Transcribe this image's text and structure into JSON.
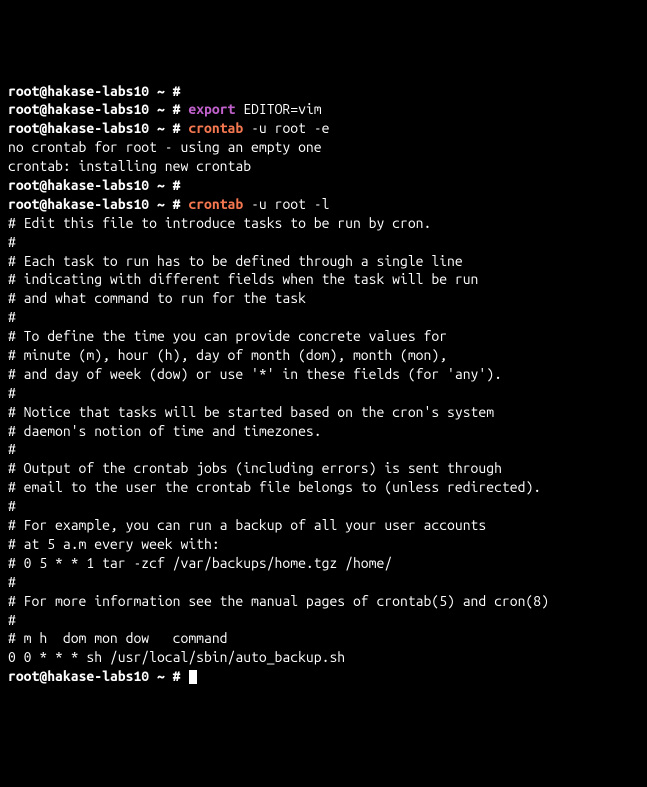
{
  "prompt": {
    "user": "root",
    "at": "@",
    "host": "hakase-labs10",
    "path": "~",
    "symbol": "#"
  },
  "lines": [
    {
      "type": "prompt",
      "cmd": []
    },
    {
      "type": "prompt",
      "cmd": [
        {
          "t": "export",
          "c": "export "
        },
        {
          "t": "plain",
          "c": "EDITOR=vim"
        }
      ]
    },
    {
      "type": "prompt",
      "cmd": [
        {
          "t": "crontab",
          "c": "crontab "
        },
        {
          "t": "plain",
          "c": "-u root -e"
        }
      ]
    },
    {
      "type": "output",
      "text": "no crontab for root - using an empty one"
    },
    {
      "type": "output",
      "text": "crontab: installing new crontab"
    },
    {
      "type": "prompt",
      "cmd": []
    },
    {
      "type": "prompt",
      "cmd": [
        {
          "t": "crontab",
          "c": "crontab "
        },
        {
          "t": "plain",
          "c": "-u root -l"
        }
      ]
    },
    {
      "type": "output",
      "text": "# Edit this file to introduce tasks to be run by cron."
    },
    {
      "type": "output",
      "text": "#"
    },
    {
      "type": "output",
      "text": "# Each task to run has to be defined through a single line"
    },
    {
      "type": "output",
      "text": "# indicating with different fields when the task will be run"
    },
    {
      "type": "output",
      "text": "# and what command to run for the task"
    },
    {
      "type": "output",
      "text": "#"
    },
    {
      "type": "output",
      "text": "# To define the time you can provide concrete values for"
    },
    {
      "type": "output",
      "text": "# minute (m), hour (h), day of month (dom), month (mon),"
    },
    {
      "type": "output",
      "text": "# and day of week (dow) or use '*' in these fields (for 'any')."
    },
    {
      "type": "output",
      "text": "#"
    },
    {
      "type": "output",
      "text": "# Notice that tasks will be started based on the cron's system"
    },
    {
      "type": "output",
      "text": "# daemon's notion of time and timezones."
    },
    {
      "type": "output",
      "text": "#"
    },
    {
      "type": "output",
      "text": "# Output of the crontab jobs (including errors) is sent through"
    },
    {
      "type": "output",
      "text": "# email to the user the crontab file belongs to (unless redirected)."
    },
    {
      "type": "output",
      "text": "#"
    },
    {
      "type": "output",
      "text": "# For example, you can run a backup of all your user accounts"
    },
    {
      "type": "output",
      "text": "# at 5 a.m every week with:"
    },
    {
      "type": "output",
      "text": "# 0 5 * * 1 tar -zcf /var/backups/home.tgz /home/"
    },
    {
      "type": "output",
      "text": "#"
    },
    {
      "type": "output",
      "text": "# For more information see the manual pages of crontab(5) and cron(8)"
    },
    {
      "type": "output",
      "text": "#"
    },
    {
      "type": "output",
      "text": "# m h  dom mon dow   command"
    },
    {
      "type": "output",
      "text": ""
    },
    {
      "type": "output",
      "text": "0 0 * * * sh /usr/local/sbin/auto_backup.sh"
    },
    {
      "type": "prompt",
      "cmd": [],
      "cursor": true
    }
  ]
}
